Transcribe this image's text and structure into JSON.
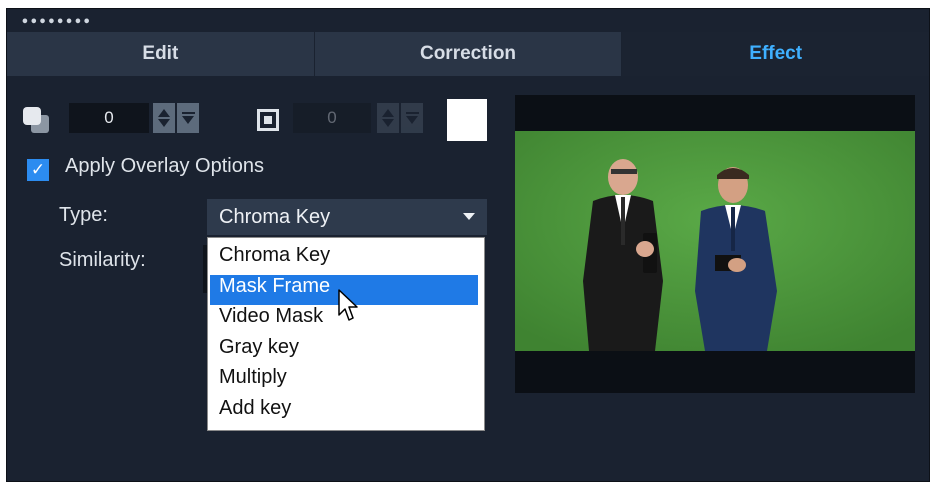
{
  "window": {
    "grip": "••••••••"
  },
  "tabs": [
    {
      "label": "Edit",
      "active": false
    },
    {
      "label": "Correction",
      "active": false
    },
    {
      "label": "Effect",
      "active": true
    }
  ],
  "toolbar": {
    "shadow_value": "0",
    "border_value": "0",
    "border_color": "#ffffff",
    "icons": [
      "shadow-icon",
      "spin-up-down-icon",
      "dropdown-icon",
      "border-icon"
    ]
  },
  "overlay": {
    "apply_label": "Apply Overlay Options",
    "apply_checked": true,
    "type_label": "Type:",
    "type_value": "Chroma Key",
    "similarity_label": "Similarity:",
    "menu_items": [
      "Chroma Key",
      "Mask Frame",
      "Video Mask",
      "Gray key",
      "Multiply",
      "Add key"
    ],
    "highlighted_item": "Mask Frame"
  },
  "colors": {
    "panel": "#1a2230",
    "accent": "#3fb0ff",
    "selection": "#1f7ae6",
    "checkbox": "#2c8cf0",
    "green_screen": "#4e9a3c"
  }
}
